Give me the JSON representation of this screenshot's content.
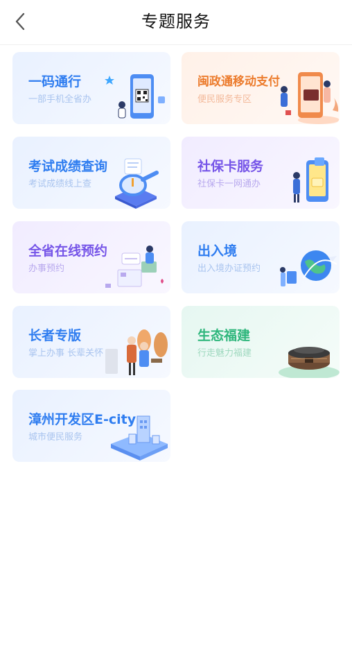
{
  "header": {
    "title": "专题服务",
    "back_icon": "chevron-left-icon"
  },
  "cards": [
    {
      "title": "一码通行",
      "subtitle": "一部手机全省办",
      "theme": "blue",
      "icon": "qr-phone-illustration"
    },
    {
      "title": "闽政通移动支付",
      "subtitle": "便民服务专区",
      "theme": "orange",
      "icon": "mobile-payment-illustration"
    },
    {
      "title": "考试成绩查询",
      "subtitle": "考试成绩线上查",
      "theme": "blue",
      "icon": "magnifier-scroll-illustration"
    },
    {
      "title": "社保卡服务",
      "subtitle": "社保卡一网通办",
      "theme": "purple",
      "icon": "social-security-card-illustration"
    },
    {
      "title": "全省在线预约",
      "subtitle": "办事预约",
      "theme": "purple",
      "icon": "online-booking-illustration"
    },
    {
      "title": "出入境",
      "subtitle": "出入境办证预约",
      "theme": "blue",
      "icon": "globe-airplane-illustration"
    },
    {
      "title": "长者专版",
      "subtitle": "掌上办事 长辈关怀",
      "theme": "blue",
      "icon": "elderly-people-illustration"
    },
    {
      "title": "生态福建",
      "subtitle": "行走魅力福建",
      "theme": "green",
      "icon": "tulou-building-illustration"
    },
    {
      "title": "漳州开发区E-city",
      "subtitle": "城市便民服务",
      "theme": "blue",
      "icon": "city-platform-illustration"
    }
  ],
  "colors": {
    "blue": "#2f7df0",
    "orange": "#ec7b2c",
    "purple": "#7655e8",
    "green": "#2fb67c"
  }
}
